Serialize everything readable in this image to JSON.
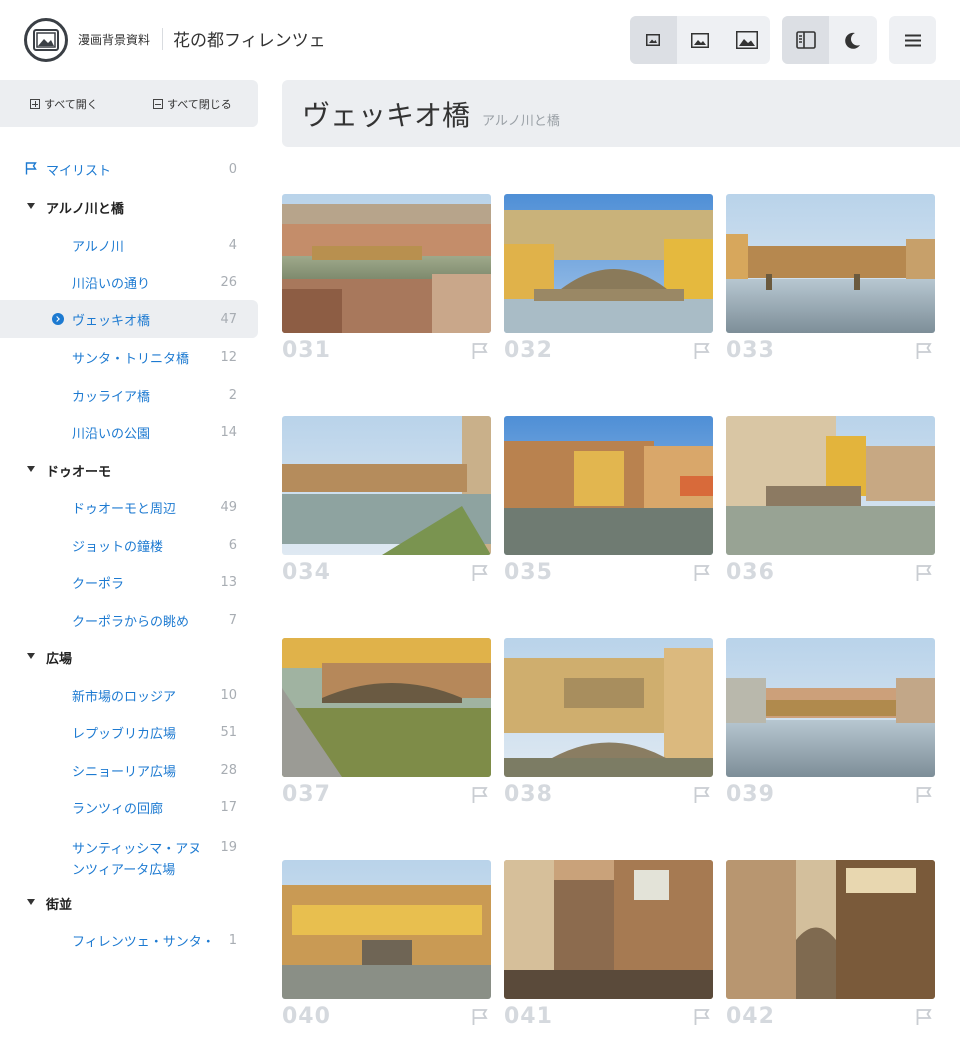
{
  "header": {
    "logo_caption": "漫画背景資料",
    "site_title": "花の都フィレンツェ",
    "icons": [
      "image-small-icon",
      "image-medium-icon",
      "image-large-icon",
      "sidebar-toggle-icon",
      "moon-icon",
      "hamburger-icon"
    ]
  },
  "sidebar": {
    "expand_all": "すべて開く",
    "collapse_all": "すべて閉じる",
    "mylist": {
      "label": "マイリスト",
      "count": "0"
    },
    "items": [
      {
        "type": "cat",
        "label": "アルノ川と橋"
      },
      {
        "type": "sub",
        "label": "アルノ川",
        "count": "4"
      },
      {
        "type": "sub",
        "label": "川沿いの通り",
        "count": "26"
      },
      {
        "type": "sub",
        "label": "ヴェッキオ橋",
        "count": "47",
        "active": true
      },
      {
        "type": "sub",
        "label": "サンタ・トリニタ橋",
        "count": "12"
      },
      {
        "type": "sub",
        "label": "カッライア橋",
        "count": "2"
      },
      {
        "type": "sub",
        "label": "川沿いの公園",
        "count": "14"
      },
      {
        "type": "cat",
        "label": "ドゥオーモ"
      },
      {
        "type": "sub",
        "label": "ドゥオーモと周辺",
        "count": "49"
      },
      {
        "type": "sub",
        "label": "ジョットの鐘楼",
        "count": "6"
      },
      {
        "type": "sub",
        "label": "クーポラ",
        "count": "13"
      },
      {
        "type": "sub",
        "label": "クーポラからの眺め",
        "count": "7"
      },
      {
        "type": "cat",
        "label": "広場"
      },
      {
        "type": "sub",
        "label": "新市場のロッジア",
        "count": "10"
      },
      {
        "type": "sub",
        "label": "レプッブリカ広場",
        "count": "51"
      },
      {
        "type": "sub",
        "label": "シニョーリア広場",
        "count": "28"
      },
      {
        "type": "sub",
        "label": "ランツィの回廊",
        "count": "17"
      },
      {
        "type": "sub",
        "label": "サンティッシマ・アヌンツィアータ広場",
        "count": "19"
      },
      {
        "type": "cat",
        "label": "街並"
      },
      {
        "type": "sub",
        "label": "フィレンツェ・サンタ・",
        "count": "1"
      }
    ]
  },
  "page": {
    "title": "ヴェッキオ橋",
    "breadcrumb": "アルノ川と橋"
  },
  "photos": [
    {
      "num": "031"
    },
    {
      "num": "032"
    },
    {
      "num": "033"
    },
    {
      "num": "034"
    },
    {
      "num": "035"
    },
    {
      "num": "036"
    },
    {
      "num": "037"
    },
    {
      "num": "038"
    },
    {
      "num": "039"
    },
    {
      "num": "040"
    },
    {
      "num": "041"
    },
    {
      "num": "042"
    }
  ],
  "colors": {
    "accent": "#1d7ad1",
    "panel": "#eceef1",
    "number": "#d5d9de"
  }
}
